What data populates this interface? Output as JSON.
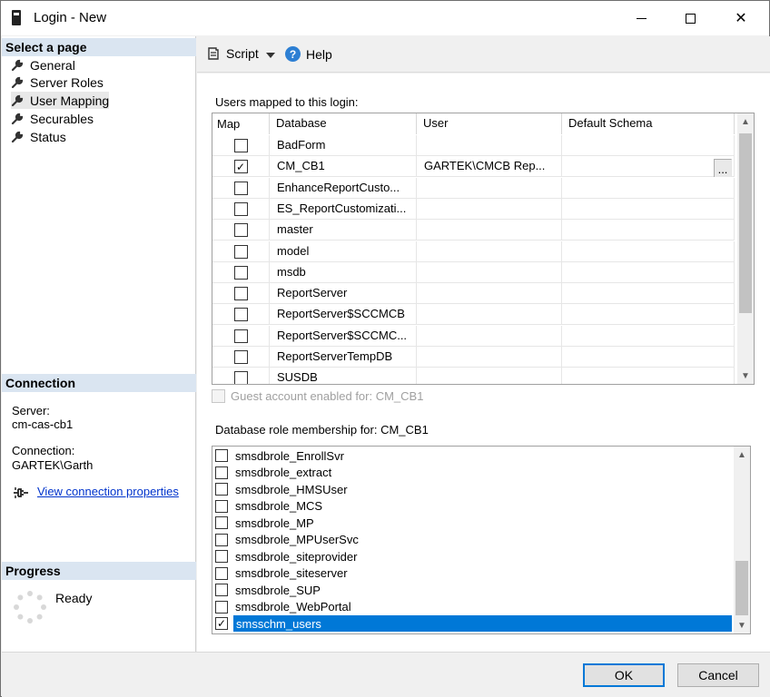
{
  "window": {
    "title": "Login - New",
    "minimize_glyph": "—",
    "maximize_glyph": "☐",
    "close_glyph": "✕"
  },
  "left": {
    "select_page_header": "Select a page",
    "pages": [
      {
        "label": "General",
        "icon": "wrench-icon"
      },
      {
        "label": "Server Roles",
        "icon": "wrench-icon"
      },
      {
        "label": "User Mapping",
        "icon": "wrench-icon",
        "selected": true
      },
      {
        "label": "Securables",
        "icon": "wrench-icon"
      },
      {
        "label": "Status",
        "icon": "wrench-icon"
      }
    ],
    "connection_header": "Connection",
    "server_label": "Server:",
    "server_value": "cm-cas-cb1",
    "connection_label": "Connection:",
    "connection_value": "GARTEK\\Garth",
    "view_connection_link": "View connection properties",
    "progress_header": "Progress",
    "progress_status": "Ready"
  },
  "toolbar": {
    "script_label": "Script",
    "help_label": "Help"
  },
  "mapping": {
    "section_label": "Users mapped to this login:",
    "columns": [
      "Map",
      "Database",
      "User",
      "Default Schema"
    ],
    "rows": [
      {
        "checked": false,
        "database": "BadForm",
        "user": "",
        "schema": ""
      },
      {
        "checked": true,
        "database": "CM_CB1",
        "user": "GARTEK\\CMCB Rep...",
        "schema": "",
        "ellipsis": "..."
      },
      {
        "checked": false,
        "database": "EnhanceReportCusto...",
        "user": "",
        "schema": ""
      },
      {
        "checked": false,
        "database": "ES_ReportCustomizati...",
        "user": "",
        "schema": ""
      },
      {
        "checked": false,
        "database": "master",
        "user": "",
        "schema": ""
      },
      {
        "checked": false,
        "database": "model",
        "user": "",
        "schema": ""
      },
      {
        "checked": false,
        "database": "msdb",
        "user": "",
        "schema": ""
      },
      {
        "checked": false,
        "database": "ReportServer",
        "user": "",
        "schema": ""
      },
      {
        "checked": false,
        "database": "ReportServer$SCCMCB",
        "user": "",
        "schema": ""
      },
      {
        "checked": false,
        "database": "ReportServer$SCCMC...",
        "user": "",
        "schema": ""
      },
      {
        "checked": false,
        "database": "ReportServerTempDB",
        "user": "",
        "schema": ""
      },
      {
        "checked": false,
        "database": "SUSDB",
        "user": "",
        "schema": ""
      }
    ],
    "guest_label": "Guest account enabled for: CM_CB1"
  },
  "roles": {
    "section_label": "Database role membership for: CM_CB1",
    "items": [
      {
        "label": "smsdbrole_EnrollSvr",
        "checked": false
      },
      {
        "label": "smsdbrole_extract",
        "checked": false
      },
      {
        "label": "smsdbrole_HMSUser",
        "checked": false
      },
      {
        "label": "smsdbrole_MCS",
        "checked": false
      },
      {
        "label": "smsdbrole_MP",
        "checked": false
      },
      {
        "label": "smsdbrole_MPUserSvc",
        "checked": false
      },
      {
        "label": "smsdbrole_siteprovider",
        "checked": false
      },
      {
        "label": "smsdbrole_siteserver",
        "checked": false
      },
      {
        "label": "smsdbrole_SUP",
        "checked": false
      },
      {
        "label": "smsdbrole_WebPortal",
        "checked": false
      },
      {
        "label": "smsschm_users",
        "checked": true,
        "selected": true
      }
    ]
  },
  "footer": {
    "ok_label": "OK",
    "cancel_label": "Cancel"
  },
  "colors": {
    "section_header_bg": "#dae5f1",
    "selection_blue": "#0078d7",
    "link_blue": "#0033cc"
  }
}
